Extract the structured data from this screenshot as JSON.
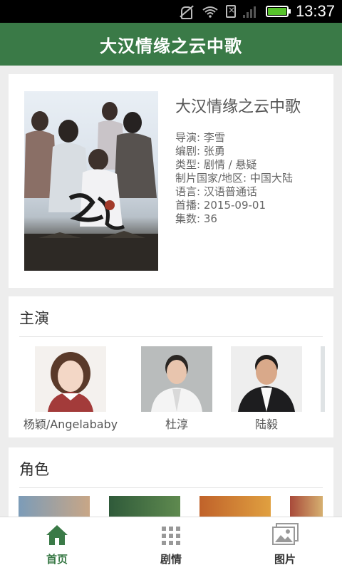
{
  "status_bar": {
    "time": "13:37"
  },
  "app_bar": {
    "title": "大汉情缘之云中歌"
  },
  "show": {
    "title": "大汉情缘之云中歌",
    "fields": [
      "导演: 李雪",
      "编剧: 张勇",
      "类型: 剧情 / 悬疑",
      "制片国家/地区: 中国大陆",
      "语言: 汉语普通话",
      "首播: 2015-09-01",
      "集数: 36"
    ]
  },
  "cast": {
    "title": "主演",
    "members": [
      {
        "name": "杨颖/Angelababy"
      },
      {
        "name": "杜淳"
      },
      {
        "name": "陆毅"
      }
    ]
  },
  "roles": {
    "title": "角色"
  },
  "tabs": [
    {
      "label": "首页",
      "icon": "home-icon",
      "active": true
    },
    {
      "label": "剧情",
      "icon": "grid-icon",
      "active": false
    },
    {
      "label": "图片",
      "icon": "gallery-icon",
      "active": false
    }
  ],
  "colors": {
    "primary": "#3a7a47",
    "background": "#ededed"
  }
}
